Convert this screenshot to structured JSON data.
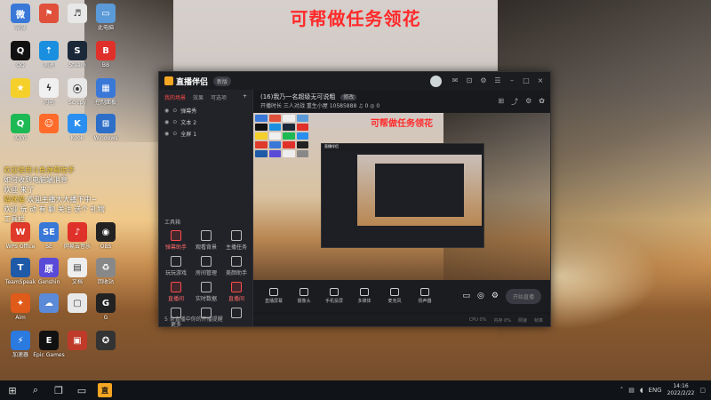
{
  "overlay_title": "可帮做任务领花",
  "desktop_icons": [
    {
      "label": "微微",
      "color": "#3a78d8",
      "glyph": "微"
    },
    {
      "label": "",
      "color": "#e0503a",
      "glyph": "⚑"
    },
    {
      "label": "",
      "color": "#e8e8e8",
      "glyph": "♬"
    },
    {
      "label": "此电脑",
      "color": "#5a9ad8",
      "glyph": "▭"
    },
    {
      "label": "QQ",
      "color": "#111",
      "glyph": "Q"
    },
    {
      "label": "测速",
      "color": "#1a8fe0",
      "glyph": "⇡"
    },
    {
      "label": "Steam",
      "color": "#1b2838",
      "glyph": "S"
    },
    {
      "label": "BB",
      "color": "#e0302a",
      "glyph": "B"
    },
    {
      "label": "",
      "color": "#f5d02a",
      "glyph": "★"
    },
    {
      "label": "闪电",
      "color": "#f0f0f0",
      "glyph": "ϟ"
    },
    {
      "label": "Scrcpy",
      "color": "#e8e8e8",
      "glyph": "⦿"
    },
    {
      "label": "控制面板",
      "color": "#3a78d8",
      "glyph": "▦"
    },
    {
      "label": "iQIYI",
      "color": "#1db954",
      "glyph": "Q"
    },
    {
      "label": "",
      "color": "#ff6b2a",
      "glyph": "☺"
    },
    {
      "label": "Kook",
      "color": "#2a8ff0",
      "glyph": "K"
    },
    {
      "label": "Windows",
      "color": "#2d6ec8",
      "glyph": "⊞"
    },
    {
      "label": "WPS Office",
      "color": "#e03a2a",
      "glyph": "W"
    },
    {
      "label": "SE",
      "color": "#3a78d8",
      "glyph": "SE"
    },
    {
      "label": "网易云音乐",
      "color": "#e0302a",
      "glyph": "♪"
    },
    {
      "label": "OBS",
      "color": "#222",
      "glyph": "◉"
    },
    {
      "label": "TeamSpeak",
      "color": "#1f5aa8",
      "glyph": "T"
    },
    {
      "label": "Genshin",
      "color": "#5a4ad8",
      "glyph": "原"
    },
    {
      "label": "文档",
      "color": "#eee",
      "glyph": "▤"
    },
    {
      "label": "回收站",
      "color": "#888",
      "glyph": "♻"
    },
    {
      "label": "Aim",
      "color": "#e05a1a",
      "glyph": "✦"
    },
    {
      "label": "",
      "color": "#5a8ad8",
      "glyph": "☁"
    },
    {
      "label": "",
      "color": "#e8e8e8",
      "glyph": "▢"
    },
    {
      "label": "G",
      "color": "#222",
      "glyph": "G"
    },
    {
      "label": "加速器",
      "color": "#2a7ae0",
      "glyph": "⚡"
    },
    {
      "label": "Epic Games",
      "color": "#111",
      "glyph": "E"
    },
    {
      "label": "",
      "color": "#c03a2a",
      "glyph": "▣"
    },
    {
      "label": "",
      "color": "#333",
      "glyph": "✪"
    }
  ],
  "chat": [
    {
      "name": "欢迎使用斗鱼弹幕助手",
      "text": ""
    },
    {
      "name": "",
      "text": "如何收到电脑端消息"
    },
    {
      "name": "",
      "text": "欢迎 来了"
    },
    {
      "name": "猫咪猫",
      "text": " 欢迎主播大大播下中~  "
    },
    {
      "name": "",
      "text": "欢迎 玩 动 有 聊 关注 送个 礼物"
    },
    {
      "name": "",
      "text": "工具栏"
    }
  ],
  "window": {
    "app_name": "直播伴侣",
    "version": "新版",
    "tabs": [
      "我的场景",
      "效果",
      "可选项"
    ],
    "scenes": [
      "弹幕秀",
      "文本 2",
      "全屏 1"
    ],
    "tool_header": "工具箱",
    "tools": [
      {
        "label": "弹幕助手",
        "red": true
      },
      {
        "label": "观看背景",
        "red": false
      },
      {
        "label": "主播任务",
        "red": false
      },
      {
        "label": "玩玩游戏",
        "red": false
      },
      {
        "label": "房间管理",
        "red": false
      },
      {
        "label": "美颜助手",
        "red": false
      },
      {
        "label": "直播间",
        "red": true
      },
      {
        "label": "实时数据",
        "red": false
      },
      {
        "label": "直播间",
        "red": true
      },
      {
        "label": "更多",
        "red": false
      },
      {
        "label": "",
        "red": false
      },
      {
        "label": "",
        "red": false
      }
    ],
    "side_footer": "5 条直播中你的开播提醒",
    "stream_title": "(16)我乃一名超级无可说粗",
    "stream_badge": "修改",
    "stream_meta": "开播时长  三人对战  重生小屋  10585888  ♫ 0  ◎ 0",
    "preview_title": "可帮做任务领花",
    "controls": [
      "直播屏幕",
      "摄像头",
      "手机投屏",
      "多媒体",
      "麦克风",
      "扬声器"
    ],
    "golive": "开始直播",
    "status": [
      "CPU 0%",
      "内存 0%",
      "网速",
      "帧率"
    ]
  },
  "taskbar": {
    "lang": "ENG",
    "time": "14:16",
    "date": "2022/2/22"
  }
}
